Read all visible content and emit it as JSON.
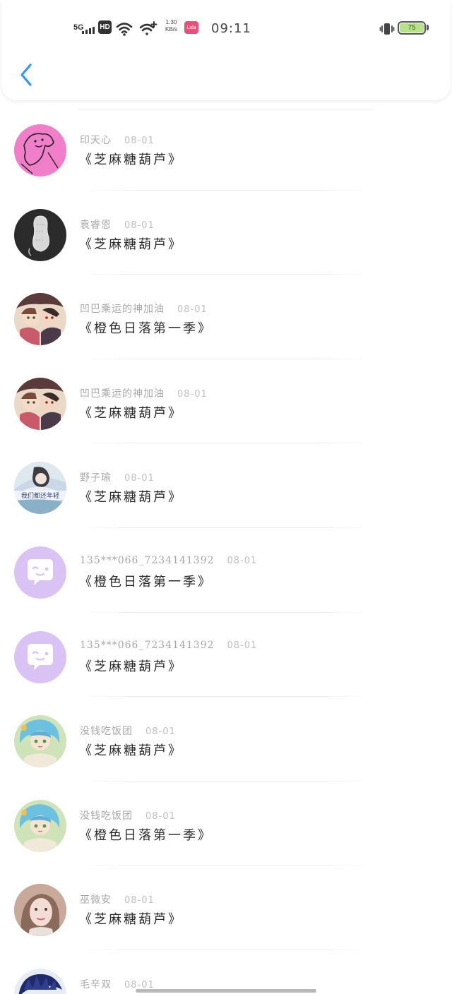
{
  "status_bar": {
    "network": "5G",
    "hd": "HD",
    "speed_value": "1.30",
    "speed_unit": "KB/s",
    "app_badge": "Lala",
    "time": "09:11",
    "battery": "75"
  },
  "comments": [
    {
      "avatar": "avatar-pink-sketch-icon",
      "username": "印天心",
      "date": "08-01",
      "title": "《芝麻糖葫芦》"
    },
    {
      "avatar": "avatar-peanut-icon",
      "username": "袁睿恩",
      "date": "08-01",
      "title": "《芝麻糖葫芦》"
    },
    {
      "avatar": "avatar-anime-pair-icon",
      "username": "凹巴乘运的神加油",
      "date": "08-01",
      "title": "《橙色日落第一季》"
    },
    {
      "avatar": "avatar-anime-pair-icon",
      "username": "凹巴乘运的神加油",
      "date": "08-01",
      "title": "《芝麻糖葫芦》"
    },
    {
      "avatar": "avatar-girl-photo-icon",
      "username": "野子瑜",
      "date": "08-01",
      "title": "《芝麻糖葫芦》",
      "avatar_caption": "我们都还年轻"
    },
    {
      "avatar": "avatar-default-chat-icon",
      "username": "135***066_7234141392",
      "date": "08-01",
      "title": "《橙色日落第一季》"
    },
    {
      "avatar": "avatar-default-chat-icon",
      "username": "135***066_7234141392",
      "date": "08-01",
      "title": "《芝麻糖葫芦》"
    },
    {
      "avatar": "avatar-anime-blue-hair-icon",
      "username": "没钱吃饭团",
      "date": "08-01",
      "title": "《芝麻糖葫芦》"
    },
    {
      "avatar": "avatar-anime-blue-hair-icon",
      "username": "没钱吃饭团",
      "date": "08-01",
      "title": "《橙色日落第一季》"
    },
    {
      "avatar": "avatar-selfie-photo-icon",
      "username": "巫微安",
      "date": "08-01",
      "title": "《芝麻糖葫芦》"
    },
    {
      "avatar": "avatar-dark-blue-icon",
      "username": "毛辛双",
      "date": "08-01",
      "title": ""
    }
  ],
  "colors": {
    "accent": "#2f9be5",
    "default_avatar": "#d9c3f5"
  }
}
